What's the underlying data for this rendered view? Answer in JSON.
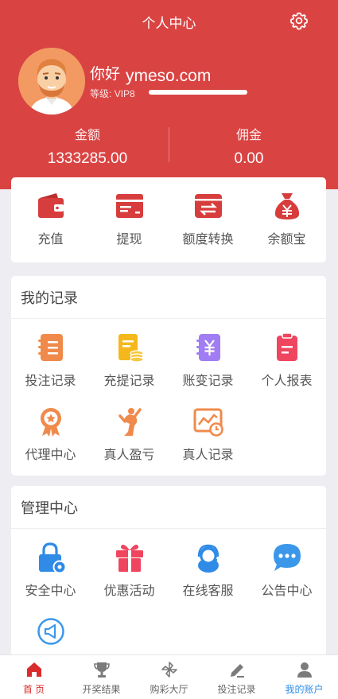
{
  "header": {
    "title": "个人中心",
    "greeting": "你好",
    "username": "ymeso.com",
    "level_label": "等级:",
    "level_value": "VIP8",
    "balance_label": "金额",
    "balance_value": "1333285.00",
    "commission_label": "佣金",
    "commission_value": "0.00",
    "bg_color": "#d94443"
  },
  "wallet": {
    "items": [
      {
        "label": "充值",
        "icon": "wallet-icon"
      },
      {
        "label": "提现",
        "icon": "card-icon"
      },
      {
        "label": "额度转换",
        "icon": "transfer-icon"
      },
      {
        "label": "余额宝",
        "icon": "money-bag-icon"
      }
    ]
  },
  "records": {
    "title": "我的记录",
    "items": [
      {
        "label": "投注记录",
        "icon": "notebook-icon"
      },
      {
        "label": "充提记录",
        "icon": "clipboard-coins-icon"
      },
      {
        "label": "账变记录",
        "icon": "yuan-book-icon"
      },
      {
        "label": "个人报表",
        "icon": "report-icon"
      },
      {
        "label": "代理中心",
        "icon": "medal-icon"
      },
      {
        "label": "真人盈亏",
        "icon": "dancer-icon"
      },
      {
        "label": "真人记录",
        "icon": "chart-clock-icon"
      }
    ]
  },
  "management": {
    "title": "管理中心",
    "items": [
      {
        "label": "安全中心",
        "icon": "lock-gear-icon"
      },
      {
        "label": "优惠活动",
        "icon": "gift-icon"
      },
      {
        "label": "在线客服",
        "icon": "headset-icon"
      },
      {
        "label": "公告中心",
        "icon": "chat-bubble-icon"
      },
      {
        "label": "",
        "icon": "megaphone-icon"
      }
    ]
  },
  "tabbar": {
    "items": [
      {
        "label": "首 页",
        "icon": "home-icon"
      },
      {
        "label": "开奖结果",
        "icon": "trophy-icon"
      },
      {
        "label": "购彩大厅",
        "icon": "pinwheel-icon"
      },
      {
        "label": "投注记录",
        "icon": "pencil-icon"
      },
      {
        "label": "我的账户",
        "icon": "user-icon"
      }
    ],
    "active_color_home": "#d92c2c",
    "active_color_account": "#2e8ee8"
  }
}
